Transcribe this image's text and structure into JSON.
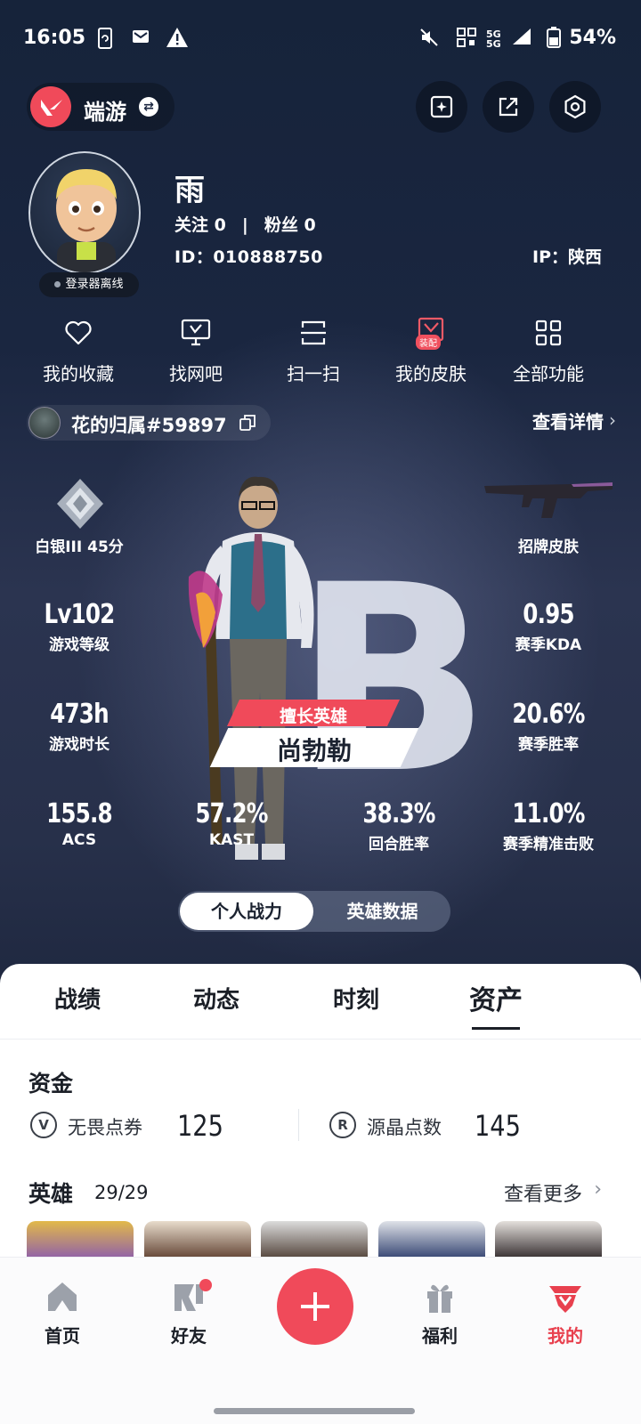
{
  "status_bar": {
    "time": "16:05",
    "battery": "54%",
    "signal_top": "5G",
    "signal_bottom": "5G"
  },
  "top_bar": {
    "game_name": "端游"
  },
  "profile": {
    "name": "雨",
    "follow_label": "关注",
    "follow_count": "0",
    "fans_label": "粉丝",
    "fans_count": "0",
    "id_text": "ID：010888750",
    "ip_text": "IP：陕西",
    "login_status": "登录器离线"
  },
  "quick_menu": [
    {
      "label": "我的收藏",
      "icon": "heart-icon"
    },
    {
      "label": "找网吧",
      "icon": "monitor-icon"
    },
    {
      "label": "扫一扫",
      "icon": "scan-icon"
    },
    {
      "label": "我的皮肤",
      "icon": "skin-icon",
      "badge": "装配"
    },
    {
      "label": "全部功能",
      "icon": "grid-icon"
    }
  ],
  "riot": {
    "name": "花的归属#59897",
    "detail_link": "查看详情"
  },
  "stats": {
    "rank": "白银III 45分",
    "skin": "招牌皮肤",
    "level_value": "Lv102",
    "level_label": "游戏等级",
    "kda_value": "0.95",
    "kda_label": "赛季KDA",
    "time_value": "473h",
    "time_label": "游戏时长",
    "winrate_value": "20.6%",
    "winrate_label": "赛季胜率",
    "acs_value": "155.8",
    "acs_label": "ACS",
    "kast_value": "57.2%",
    "kast_label": "KAST",
    "round_value": "38.3%",
    "round_label": "回合胜率",
    "precise_value": "11.0%",
    "precise_label": "赛季精准击败",
    "best_hero_tag": "擅长英雄",
    "best_hero_name": "尚勃勒",
    "grade": "B"
  },
  "toggle": {
    "left": "个人战力",
    "right": "英雄数据"
  },
  "tabs": [
    "战绩",
    "动态",
    "时刻",
    "资产"
  ],
  "funds": {
    "title": "资金",
    "items": [
      {
        "name": "无畏点券",
        "value": "125",
        "icon": "V"
      },
      {
        "name": "源晶点数",
        "value": "145",
        "icon": "R"
      }
    ]
  },
  "heroes": {
    "title": "英雄",
    "count": "29/29",
    "more": "查看更多"
  },
  "bottom_nav": [
    {
      "label": "首页",
      "icon": "home-icon"
    },
    {
      "label": "好友",
      "icon": "friends-icon"
    },
    {
      "label": "福利",
      "icon": "gift-icon"
    },
    {
      "label": "我的",
      "icon": "profile-icon"
    }
  ],
  "colors": {
    "accent": "#f04a5a",
    "bg_dark": "#16233a",
    "sheet": "#ffffff"
  }
}
